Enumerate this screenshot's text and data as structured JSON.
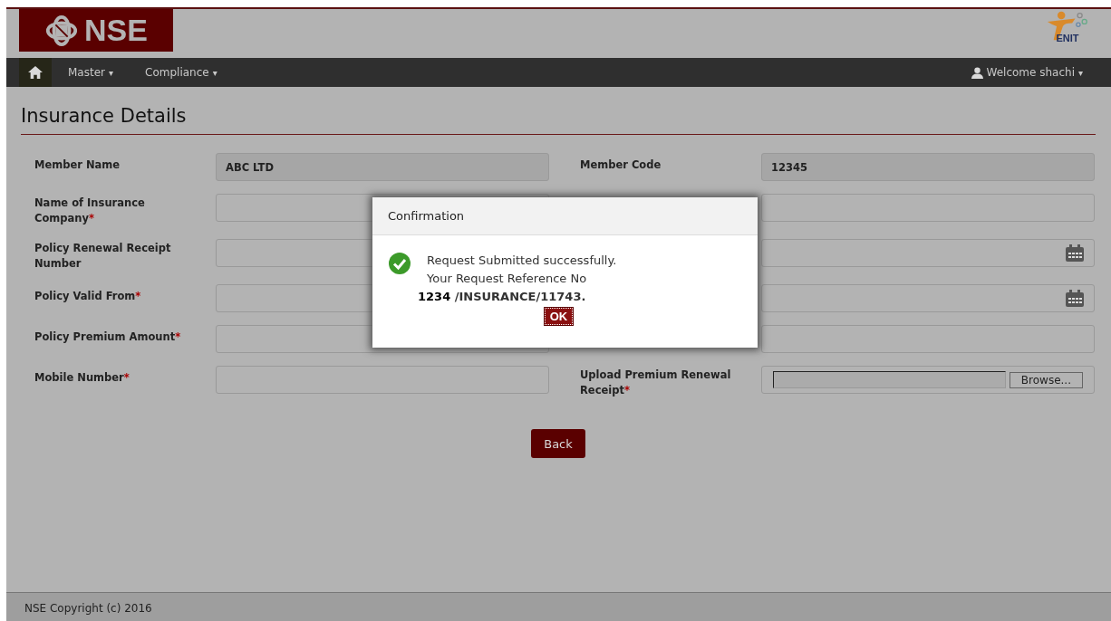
{
  "header": {
    "logo_text": "NSE",
    "partner_logo_text": "ENIT"
  },
  "nav": {
    "items": [
      {
        "label": "Master",
        "caret": "▾"
      },
      {
        "label": "Compliance",
        "caret": "▾"
      }
    ],
    "user": {
      "label": "Welcome shachi",
      "caret": "▾"
    }
  },
  "page_title": "Insurance Details",
  "rows": [
    [
      {
        "kind": "text",
        "label": "Member Name",
        "readonly": true,
        "value": "ABC LTD"
      },
      {
        "kind": "text",
        "label": "Member Code",
        "readonly": true,
        "value": "12345"
      }
    ],
    [
      {
        "kind": "text",
        "label": "Name of Insurance Company",
        "required_mark": "*",
        "readonly": false
      },
      {
        "kind": "text",
        "readonly": false
      }
    ],
    [
      {
        "kind": "text",
        "label": "Policy Renewal Receipt Number",
        "readonly": false
      },
      {
        "kind": "date"
      }
    ],
    [
      {
        "kind": "text",
        "label": "Policy Valid From",
        "required_mark": "*",
        "readonly": false
      },
      {
        "kind": "date"
      }
    ],
    [
      {
        "kind": "text",
        "label": "Policy Premium Amount",
        "required_mark": "*",
        "readonly": false
      },
      {
        "kind": "text",
        "readonly": false
      }
    ],
    [
      {
        "kind": "text",
        "label": "Mobile Number",
        "required_mark": "*",
        "readonly": false
      },
      {
        "kind": "file",
        "label": "Upload Premium Renewal Receipt",
        "required_mark": "*",
        "button": "Browse..."
      }
    ]
  ],
  "back_button": "Back",
  "dialog": {
    "title": "Confirmation",
    "lines": [
      "Request Submitted successfully.",
      "Your Request Reference No"
    ],
    "reference_number": "1234",
    "reference_suffix": "/INSURANCE/11743.",
    "ok_button": "OK"
  },
  "footer": "NSE Copyright (c) 2016"
}
